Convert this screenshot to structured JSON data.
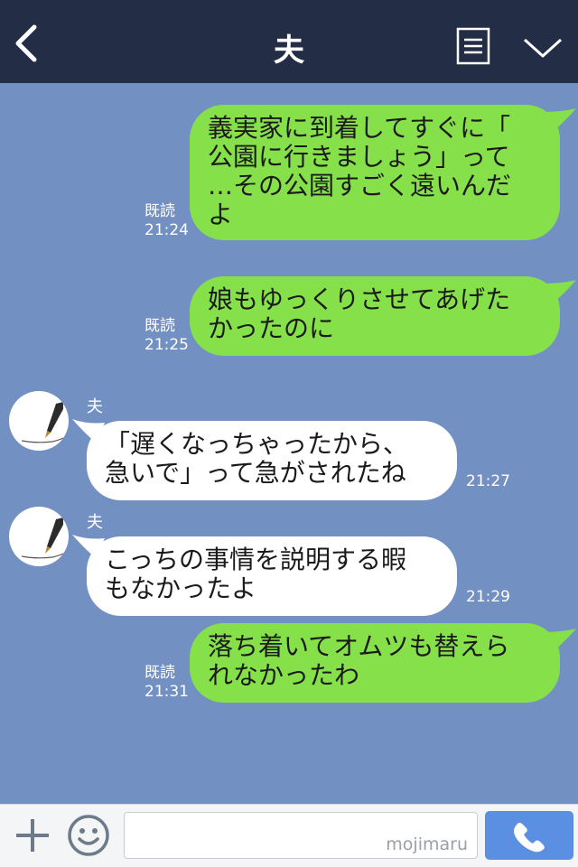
{
  "header": {
    "title": "夫",
    "back_icon": "back-chevron-icon",
    "menu_icon": "menu-list-icon",
    "dropdown_icon": "chevron-down-icon",
    "background_color": "#232d45"
  },
  "chat": {
    "background_color": "#7290c1",
    "messages": [
      {
        "side": "mine",
        "text": "義実家に到着してすぐに「\n公園に行きましょう」って\n…その公園すごく遠いんだ\nよ",
        "read": "既読",
        "time": "21:24"
      },
      {
        "side": "mine",
        "text": "娘もゆっくりさせてあげた\nかったのに",
        "read": "既読",
        "time": "21:25"
      },
      {
        "side": "theirs",
        "sender": "夫",
        "text": "「遅くなっちゃったから、\n急いで」って急がされたね",
        "time": "21:27"
      },
      {
        "side": "theirs",
        "sender": "夫",
        "text": "こっちの事情を説明する暇\nもなかったよ",
        "time": "21:29"
      },
      {
        "side": "mine",
        "text": "落ち着いてオムツも替えら\nれなかったわ",
        "read": "既読",
        "time": "21:31"
      }
    ],
    "my_bubble_color": "#86e04a",
    "their_bubble_color": "#ffffff"
  },
  "footer": {
    "plus_icon": "plus-icon",
    "emoji_icon": "smiley-icon",
    "input_value": "",
    "watermark": "mojimaru",
    "call_icon": "phone-icon",
    "call_button_color": "#5a8fe2"
  }
}
